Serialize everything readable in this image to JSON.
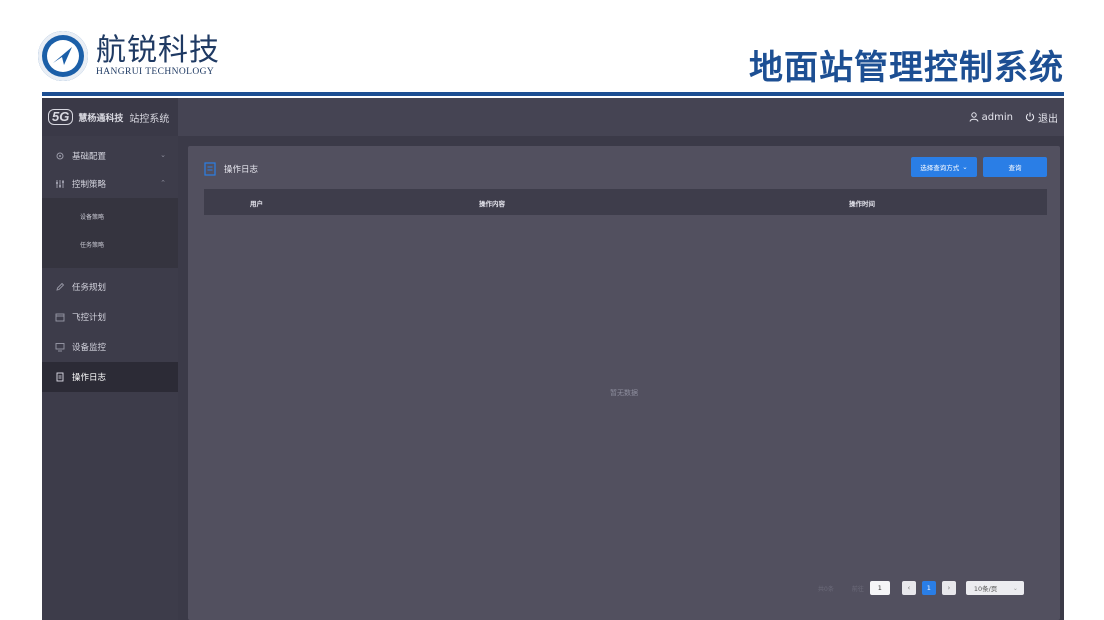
{
  "slide": {
    "brand_cn": "航锐科技",
    "brand_en": "HANGRUI TECHNOLOGY",
    "title": "地面站管理控制系统"
  },
  "app": {
    "topbar": {
      "logo_mark": "5G",
      "logo_name": "慧杨通科技",
      "system_name": "站控系统",
      "user": "admin",
      "logout": "退出"
    },
    "sidebar": {
      "items": [
        {
          "label": "基础配置",
          "icon": "gear-icon",
          "expandable": true
        },
        {
          "label": "控制策略",
          "icon": "sliders-icon",
          "expandable": true,
          "expanded": true,
          "children": [
            {
              "label": "设备策略"
            },
            {
              "label": "任务策略"
            }
          ]
        },
        {
          "label": "任务规划",
          "icon": "edit-icon"
        },
        {
          "label": "飞控计划",
          "icon": "calendar-icon"
        },
        {
          "label": "设备监控",
          "icon": "monitor-icon"
        },
        {
          "label": "操作日志",
          "icon": "document-icon",
          "active": true
        }
      ]
    },
    "panel": {
      "title": "操作日志",
      "select_button": "选择查询方式",
      "query_button": "查询",
      "columns": [
        "用户",
        "操作内容",
        "操作时间"
      ],
      "empty_text": "暂无数据",
      "pagination": {
        "total": "共0条",
        "goto": "前往",
        "page_input": "1",
        "current_page": "1",
        "page_size": "10条/页"
      }
    },
    "colors": {
      "accent": "#2a7ee6",
      "title_blue": "#1d4f93",
      "sidebar_bg": "#3d3c4a",
      "panel_bg": "#52505f"
    }
  }
}
